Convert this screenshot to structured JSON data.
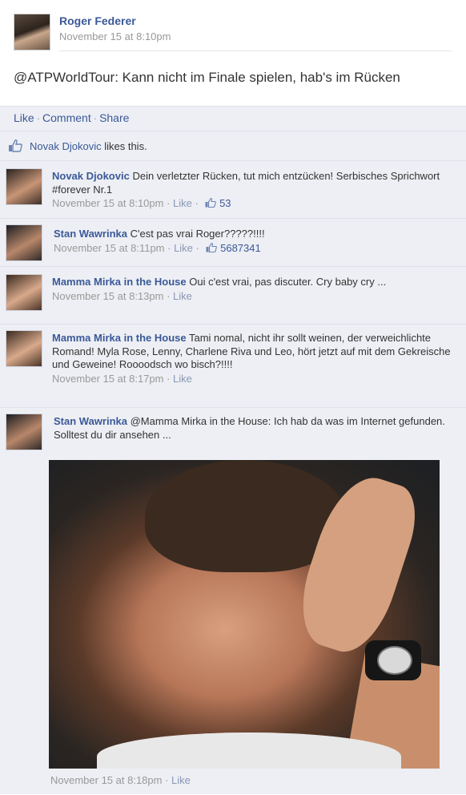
{
  "post": {
    "author": "Roger Federer",
    "timestamp": "November 15 at 8:10pm",
    "text": "@ATPWorldTour: Kann nicht im Finale spielen, hab's im Rücken"
  },
  "actions": {
    "like": "Like",
    "comment": "Comment",
    "share": "Share",
    "separator": "·"
  },
  "likes": {
    "name": "Novak Djokovic",
    "suffix": "likes this."
  },
  "comments": [
    {
      "name": "Novak Djokovic",
      "text": "Dein verletzter Rücken, tut mich entzücken! Serbisches Sprichwort #forever Nr.1",
      "time": "November 15 at 8:10pm",
      "like": "Like",
      "likes_count": "53"
    },
    {
      "name": "Stan Wawrinka",
      "text": "C'est pas vrai Roger?????!!!!",
      "time": "November 15 at 8:11pm",
      "like": "Like",
      "likes_count": "5687341"
    },
    {
      "name": "Mamma Mirka in the House",
      "text": "Oui c'est vrai, pas discuter. Cry baby cry ...",
      "time": "November 15 at 8:13pm",
      "like": "Like"
    },
    {
      "name": "Mamma Mirka in the House",
      "text": "Tami nomal, nicht ihr sollt weinen, der verweichlichte Romand! Myla Rose, Lenny, Charlene Riva und Leo, hört jetzt auf mit dem Gekreische und Geweine! Roooodsch wo bisch?!!!!",
      "time": "November 15 at 8:17pm",
      "like": "Like"
    },
    {
      "name": "Stan Wawrinka",
      "text": "@Mamma Mirka in the House: Ich hab da was im Internet gefunden. Solltest du dir ansehen ...",
      "time": "November 15 at 8:18pm",
      "like": "Like"
    }
  ],
  "icons": {
    "like_thumb": "thumbs-up-icon",
    "accent": "#3b5998"
  }
}
